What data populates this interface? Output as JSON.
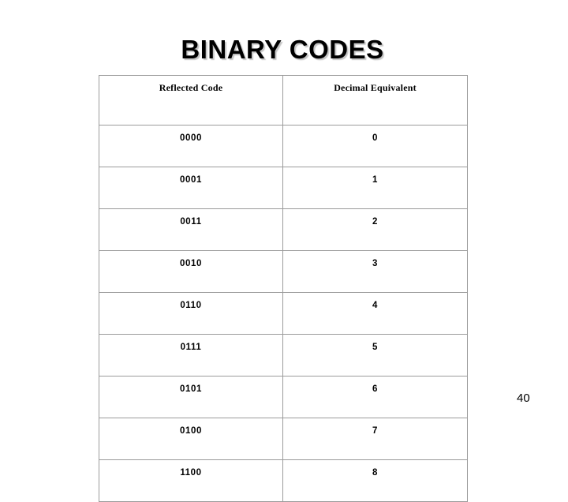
{
  "slide": {
    "title": "BINARY CODES",
    "page_number": "40",
    "background_color": "#ffffff",
    "text_color": "#000000",
    "border_color": "#9b9b9b"
  },
  "table": {
    "headers": [
      "Reflected Code",
      "Decimal Equivalent"
    ],
    "rows": [
      {
        "reflected_code": "0000",
        "decimal_equivalent": "0"
      },
      {
        "reflected_code": "0001",
        "decimal_equivalent": "1"
      },
      {
        "reflected_code": "0011",
        "decimal_equivalent": "2"
      },
      {
        "reflected_code": "0010",
        "decimal_equivalent": "3"
      },
      {
        "reflected_code": "0110",
        "decimal_equivalent": "4"
      },
      {
        "reflected_code": "0111",
        "decimal_equivalent": "5"
      },
      {
        "reflected_code": "0101",
        "decimal_equivalent": "6"
      },
      {
        "reflected_code": "0100",
        "decimal_equivalent": "7"
      },
      {
        "reflected_code": "1100",
        "decimal_equivalent": "8"
      }
    ]
  },
  "chart_data": {
    "type": "table",
    "title": "BINARY CODES",
    "columns": [
      "Reflected Code",
      "Decimal Equivalent"
    ],
    "rows": [
      [
        "0000",
        "0"
      ],
      [
        "0001",
        "1"
      ],
      [
        "0011",
        "2"
      ],
      [
        "0010",
        "3"
      ],
      [
        "0110",
        "4"
      ],
      [
        "0111",
        "5"
      ],
      [
        "0101",
        "6"
      ],
      [
        "0100",
        "7"
      ],
      [
        "1100",
        "8"
      ]
    ]
  }
}
